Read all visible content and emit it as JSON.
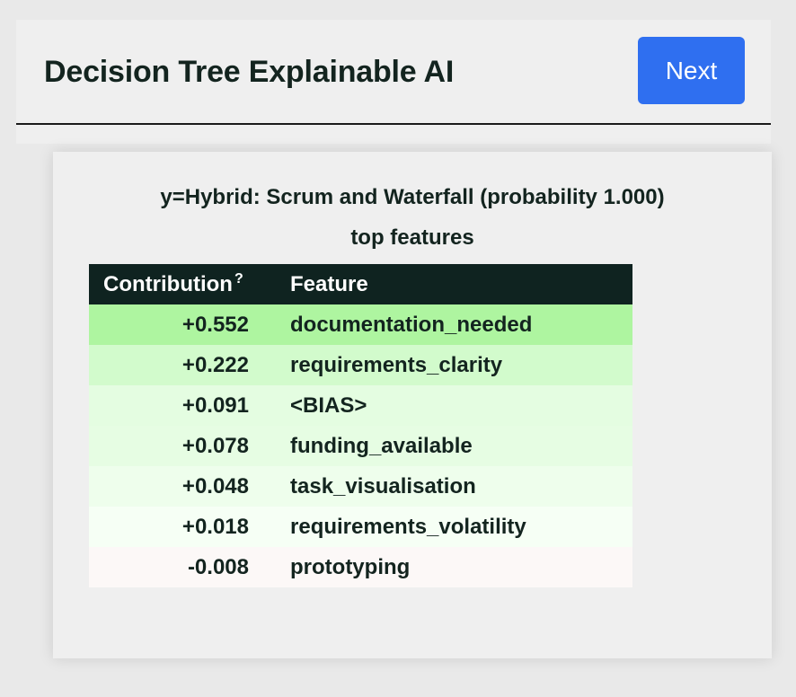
{
  "header": {
    "title": "Decision Tree Explainable AI",
    "next_label": "Next"
  },
  "explanation": {
    "heading_line1": "y=Hybrid: Scrum and Waterfall (probability 1.000)",
    "heading_line2": "top features",
    "columns": {
      "contribution": "Contribution",
      "contribution_help": "?",
      "feature": "Feature"
    },
    "rows": [
      {
        "contribution": "+0.552",
        "feature": "documentation_needed",
        "bg": "#aef5a0"
      },
      {
        "contribution": "+0.222",
        "feature": "requirements_clarity",
        "bg": "#d2fbcc"
      },
      {
        "contribution": "+0.091",
        "feature": "<BIAS>",
        "bg": "#e4fde1"
      },
      {
        "contribution": "+0.078",
        "feature": "funding_available",
        "bg": "#e6fde3"
      },
      {
        "contribution": "+0.048",
        "feature": "task_visualisation",
        "bg": "#eefeec"
      },
      {
        "contribution": "+0.018",
        "feature": "requirements_volatility",
        "bg": "#f6fff5"
      },
      {
        "contribution": "-0.008",
        "feature": "prototyping",
        "bg": "#fcf8f7"
      }
    ]
  }
}
